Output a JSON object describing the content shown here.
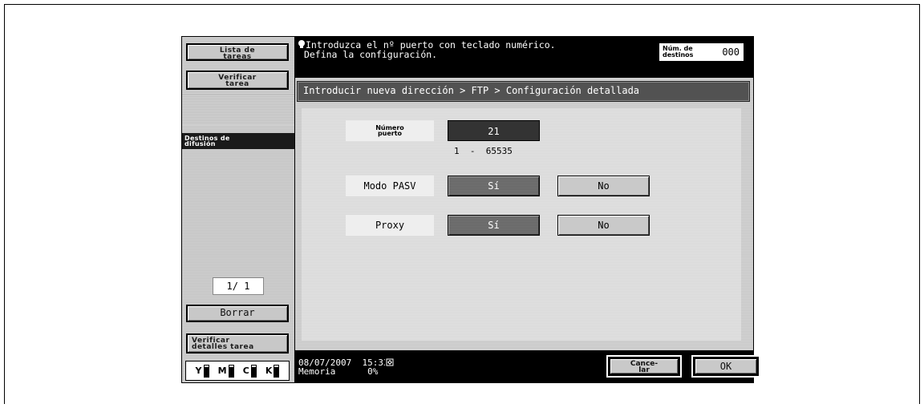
{
  "left_panel": {
    "job_list_button": {
      "line1": "Lista de",
      "line2": "tareas"
    },
    "verify_job_button": {
      "line1": "Verificar",
      "line2": "tarea"
    },
    "broadcast_header": {
      "line1": "Destinos de",
      "line2": "difusión"
    },
    "page_indicator": "1/ 1",
    "delete_button": "Borrar",
    "job_details_button": {
      "line1": "Verificar",
      "line2": "detalles tarea"
    },
    "toner": [
      {
        "label": "Y",
        "level": 0.85
      },
      {
        "label": "M",
        "level": 0.85
      },
      {
        "label": "C",
        "level": 0.85
      },
      {
        "label": "K",
        "level": 0.85
      }
    ]
  },
  "header": {
    "message_line1": "Introduzca el nº puerto con teclado numérico.",
    "message_line2": "Defina la configuración.",
    "destinations_label": {
      "line1": "Núm. de",
      "line2": "destinos"
    },
    "destinations_count": "000"
  },
  "breadcrumb": "Introducir nueva dirección > FTP > Configuración detallada",
  "form": {
    "port_label": {
      "line1": "Número",
      "line2": "puerto"
    },
    "port_value": "21",
    "port_range": "1  -  65535",
    "pasv_label": "Modo PASV",
    "pasv_yes": "Sí",
    "pasv_no": "No",
    "pasv_selected": "yes",
    "proxy_label": "Proxy",
    "proxy_yes": "Sí",
    "proxy_no": "No",
    "proxy_selected": "yes"
  },
  "footer": {
    "date": "08/07/2007",
    "time": "15:33",
    "memory_label": "Memoria",
    "memory_value": "0%",
    "network_icon": "network-status-icon",
    "cancel_button": {
      "line1": "Cance-",
      "line2": "lar"
    },
    "ok_button": "OK"
  }
}
